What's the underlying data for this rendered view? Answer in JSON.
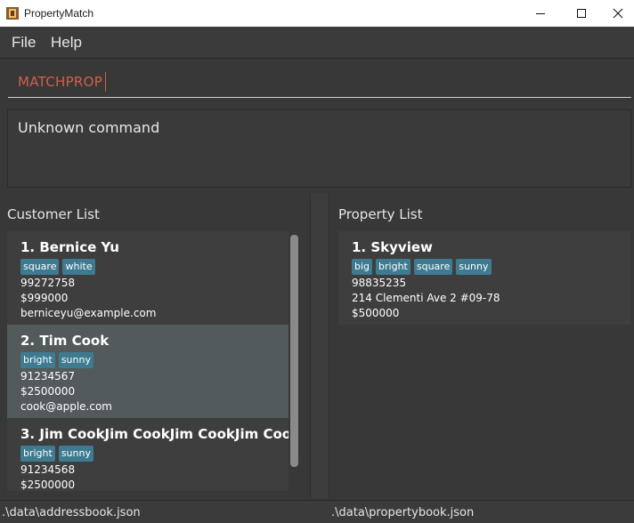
{
  "window": {
    "title": "PropertyMatch",
    "icons": {
      "app": "house-app-icon",
      "minimize": "minimize-icon",
      "maximize": "maximize-icon",
      "close": "close-icon"
    }
  },
  "menu": {
    "file": "File",
    "help": "Help"
  },
  "command": {
    "value": "MATCHPROP"
  },
  "result": {
    "text": "Unknown command"
  },
  "customers": {
    "title": "Customer List",
    "items": [
      {
        "index": "1.",
        "name": "Bernice Yu",
        "tags": [
          "square",
          "white"
        ],
        "phone": "99272758",
        "budget": "$999000",
        "email": "berniceyu@example.com"
      },
      {
        "index": "2.",
        "name": "Tim Cook",
        "tags": [
          "bright",
          "sunny"
        ],
        "phone": "91234567",
        "budget": "$2500000",
        "email": "cook@apple.com"
      },
      {
        "index": "3.",
        "name": "Jim CookJim CookJim CookJim Coo...",
        "tags": [
          "bright",
          "sunny"
        ],
        "phone": "91234568",
        "budget": "$2500000",
        "email": ""
      }
    ]
  },
  "properties": {
    "title": "Property List",
    "items": [
      {
        "index": "1.",
        "name": "Skyview",
        "tags": [
          "big",
          "bright",
          "square",
          "sunny"
        ],
        "phone": "98835235",
        "address": "214 Clementi Ave 2 #09-78",
        "price": "$500000"
      }
    ]
  },
  "status": {
    "customers_file": ".\\data\\addressbook.json",
    "properties_file": ".\\data\\propertybook.json"
  },
  "colors": {
    "background": "#383838",
    "tag": "#3e7b91",
    "command_text": "#d0604a",
    "selected_card": "#525a5c"
  }
}
